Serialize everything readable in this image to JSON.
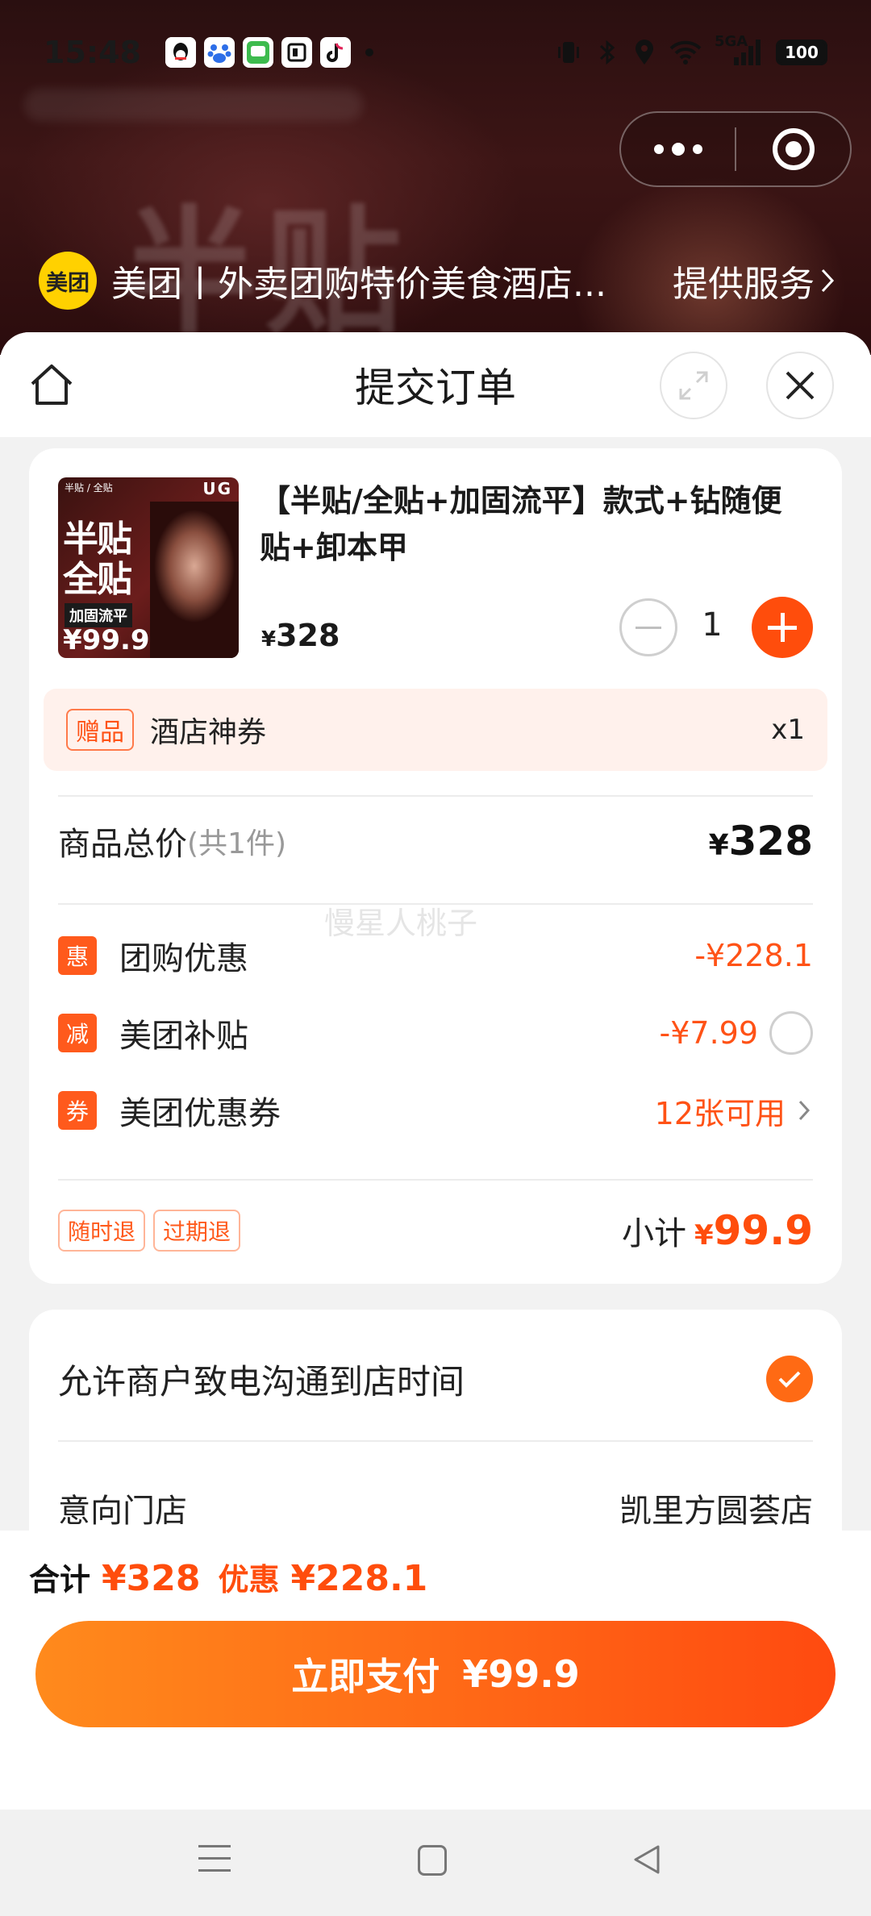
{
  "status_bar": {
    "time": "15:48",
    "network_label": "5GA",
    "battery": "100",
    "notification_icons": [
      "qq-icon",
      "baidu-icon",
      "messages-icon",
      "app-icon",
      "douyin-icon"
    ]
  },
  "mini_program": {
    "logo_text": "美团",
    "name": "美团丨外卖团购特价美食酒店...",
    "service_label": "提供服务",
    "backdrop_text": "半贴"
  },
  "sheet": {
    "title": "提交订单"
  },
  "product": {
    "thumb": {
      "top_small": "半贴 / 全贴",
      "brand": "UG",
      "big_line1": "半贴",
      "big_line2": "全贴",
      "tag": "加固流平",
      "price": "¥99.9"
    },
    "name": "【半贴/全贴+加固流平】款式+钻随便贴+卸本甲",
    "price_symbol": "¥",
    "price": "328",
    "quantity": "1"
  },
  "gift": {
    "badge": "赠品",
    "name": "酒店神券",
    "qty": "x1"
  },
  "totals": {
    "label": "商品总价",
    "count": "(共1件)",
    "amount_symbol": "¥",
    "amount": "328"
  },
  "watermark": "慢星人桃子",
  "discounts": [
    {
      "icon": "惠",
      "label": "团购优惠",
      "value": "-¥228.1"
    },
    {
      "icon": "减",
      "label": "美团补贴",
      "value": "-¥7.99"
    },
    {
      "icon": "券",
      "label": "美团优惠券",
      "value": "12张可用"
    }
  ],
  "policies": [
    "随时退",
    "过期退"
  ],
  "subtotal": {
    "label": "小计",
    "symbol": "¥",
    "amount": "99.9"
  },
  "contact": {
    "allow_call_label": "允许商户致电沟通到店时间",
    "allow_call_checked": true,
    "store_label": "意向门店",
    "store_value": "凯里方圆荟店"
  },
  "pay_bar": {
    "sum_label": "合计",
    "sum_amount": "¥328",
    "discount_label": "优惠",
    "discount_amount": "¥228.1",
    "button_label": "立即支付",
    "button_amount": "¥99.9"
  },
  "colors": {
    "accent": "#ff4d0c",
    "mini_logo": "#ffd100",
    "gift_bg": "#fff1ec"
  }
}
